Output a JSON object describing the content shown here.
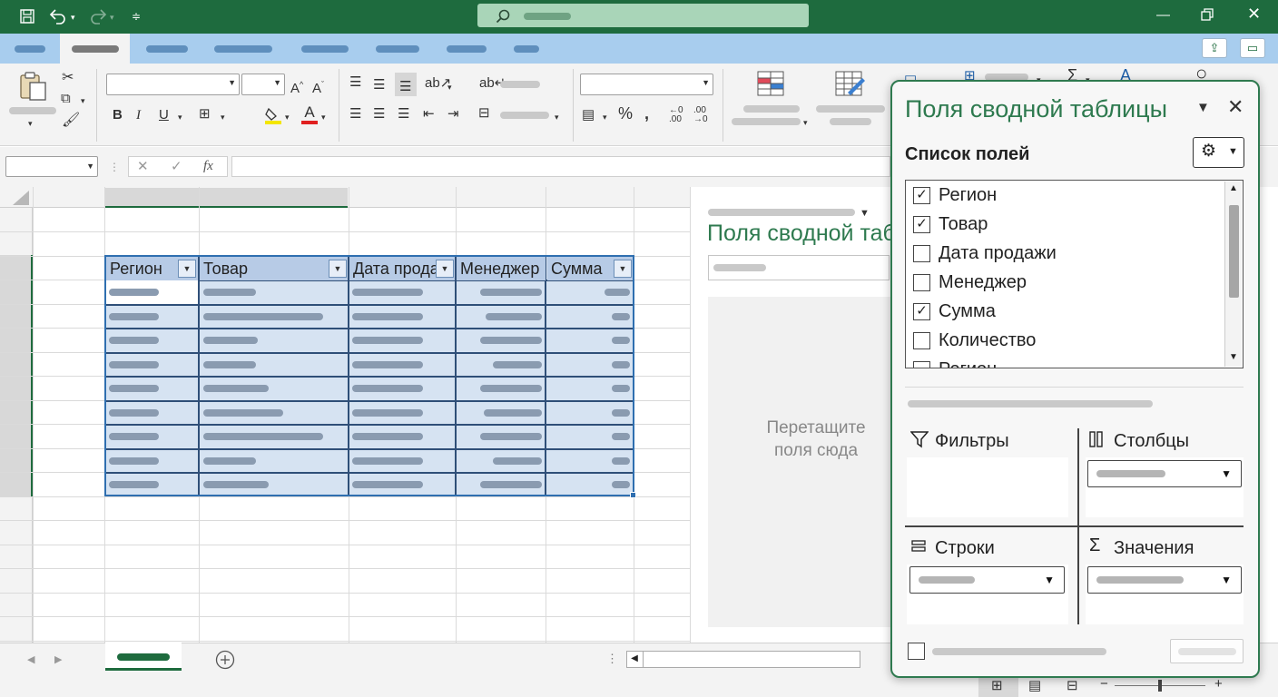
{
  "window": {
    "title_search_icon": "search-icon"
  },
  "formula_bar": {
    "fx_label": "fx"
  },
  "table": {
    "headers": [
      "Регион",
      "Товар",
      "Дата прода",
      "Менеджер",
      "Сумма"
    ]
  },
  "pivot_sheet_area": {
    "title": "Поля сводной таб",
    "hint_line1": "Перетащите",
    "hint_line2": "поля сюда"
  },
  "pane": {
    "title": "Поля сводной таблицы",
    "fields_label": "Список полей",
    "fields": [
      {
        "label": "Регион",
        "checked": true
      },
      {
        "label": "Товар",
        "checked": true
      },
      {
        "label": "Дата продажи",
        "checked": false
      },
      {
        "label": "Менеджер",
        "checked": false
      },
      {
        "label": "Сумма",
        "checked": true
      },
      {
        "label": "Количество",
        "checked": false
      },
      {
        "label": "Регион",
        "checked": false
      }
    ],
    "zones": {
      "filters": "Фильтры",
      "columns": "Столбцы",
      "rows": "Строки",
      "values": "Значения"
    }
  },
  "colors": {
    "title_bar": "#1e6b3e",
    "tab_bar": "#a8cdee",
    "table_border": "#2f6fb0",
    "table_fill": "#d6e3f2",
    "table_header_fill": "#b7cbe6",
    "pane_border": "#2f7a50",
    "pane_title": "#2e7a4f"
  }
}
